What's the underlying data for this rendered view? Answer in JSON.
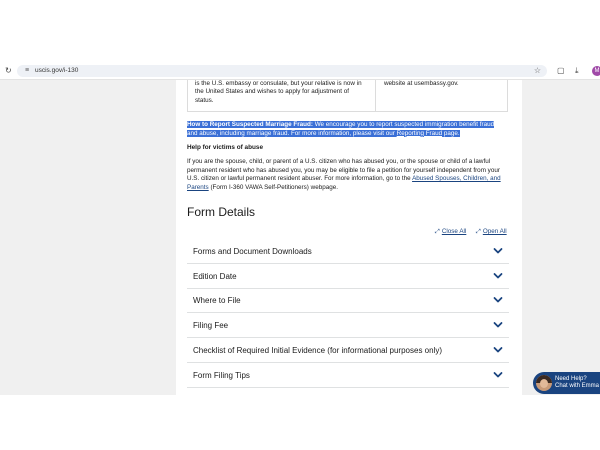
{
  "browser": {
    "url": "uscis.gov/i-130",
    "reload_icon": "reload-icon",
    "site_icon": "site-settings-icon",
    "star_icon": "bookmark-star-icon",
    "profile_initial": "M"
  },
  "table": {
    "cell1": "is the U.S. embassy or consulate, but your relative is now in the United States and wishes to apply for adjustment of status.",
    "cell2": "website at usembassy.gov."
  },
  "fraud": {
    "bold": "How to Report Suspected Marriage Fraud:",
    "text": " We encourage you to report suspected immigration benefit fraud and abuse, including marriage fraud. For more information, please visit our ",
    "link": "Reporting Fraud",
    "end": " page."
  },
  "help": {
    "heading": "Help for victims of abuse",
    "text": "If you are the spouse, child, or parent of a U.S. citizen who has abused you, or the spouse or child of a lawful permanent resident who has abused you, you may be eligible to file a petition for yourself independent from your U.S. citizen or lawful permanent resident abuser. For more information, go to the ",
    "link": "Abused Spouses, Children, and Parents",
    "end": " (Form I-360 VAWA Self-Petitioners) webpage."
  },
  "form_details": {
    "title": "Form Details",
    "close_all": "Close All",
    "open_all": "Open All",
    "items": [
      {
        "label": "Forms and Document Downloads"
      },
      {
        "label": "Edition Date"
      },
      {
        "label": "Where to File"
      },
      {
        "label": "Filing Fee"
      },
      {
        "label": "Checklist of Required Initial Evidence (for informational purposes only)"
      },
      {
        "label": "Form Filing Tips"
      }
    ]
  },
  "chat": {
    "line1": "Need Help?",
    "line2": "Chat with Emma"
  },
  "colors": {
    "link": "#1a4480",
    "highlight": "#3a6fd6",
    "chat_bg": "#1a4480",
    "gutter": "#f0f0f0"
  }
}
